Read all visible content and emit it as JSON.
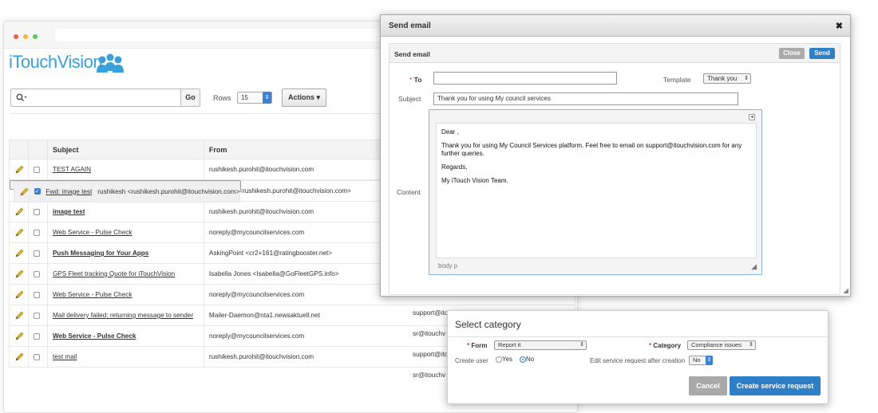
{
  "app": {
    "logo_text": "iTouchVision",
    "search": {
      "go_label": "Go",
      "placeholder": ""
    },
    "rows": {
      "label": "Rows",
      "value": "15"
    },
    "actions_label": "Actions"
  },
  "grid": {
    "columns": [
      "Subject",
      "From"
    ],
    "rows": [
      {
        "subject": "TEST AGAIN",
        "from": "rushikesh.purohit@itouchvision.com",
        "bold": false,
        "checked": false
      },
      {
        "subject": "Fwd: image test",
        "from": "rushikesh <rushikesh.purohit@itouchvision.com>",
        "bold": false,
        "checked": true
      },
      {
        "subject": "image test",
        "from": "rushikesh <rushikesh.purohit@itouchvision.com>",
        "bold": false,
        "checked": false
      },
      {
        "subject": "image test",
        "from": "rushikesh.purohit@itouchvision.com",
        "bold": true,
        "checked": false
      },
      {
        "subject": "Web Service - Pulse Check",
        "from": "noreply@mycouncilservices.com",
        "bold": false,
        "checked": false
      },
      {
        "subject": "Push Messaging for Your Apps",
        "from": "AskingPoint <cr2+161@ratingbooster.net>",
        "bold": true,
        "checked": false
      },
      {
        "subject": "GPS Fleet tracking Quote for iTouchVision",
        "from": "Isabella Jones <Isabella@GoFleetGPS.info>",
        "bold": false,
        "checked": false
      },
      {
        "subject": "Web Service - Pulse Check",
        "from": "noreply@mycouncilservices.com",
        "bold": false,
        "checked": false
      },
      {
        "subject": "Mail delivery failed: returning message to sender",
        "from": "Mailer-Daemon@nta1.newsaktuell.net",
        "bold": false,
        "checked": false
      },
      {
        "subject": "Web Service - Pulse Check",
        "from": "noreply@mycouncilservices.com",
        "bold": true,
        "checked": false
      },
      {
        "subject": "test mail",
        "from": "rushikesh.purohit@itouchvision.com",
        "bold": false,
        "checked": false
      }
    ],
    "partial_to": [
      "support@ito",
      "sr@itouchv",
      "support@ito",
      "sr@itouchv"
    ]
  },
  "send_email": {
    "window_title": "Send email",
    "panel_title": "Send email",
    "close_label": "Close",
    "send_label": "Send",
    "to_label": "To",
    "to_value": "",
    "template_label": "Template",
    "template_value": "Thank you",
    "subject_label": "Subject",
    "subject_value": "Thank you   for using My council services",
    "content_label": "Content",
    "content_lines": [
      "Dear ,",
      "Thank you for using My Council Services platform. Feel free to email on support@itouchvision.com for any further queries.",
      "Regards,",
      "My iTouch Vision Team."
    ],
    "status_path": "body  p"
  },
  "select_category": {
    "title": "Select category",
    "form_label": "Form",
    "form_value": "Report it",
    "category_label": "Category",
    "category_value": "Compliance issues",
    "create_user_label": "Create user",
    "yes_label": "Yes",
    "no_label": "No",
    "edit_label": "Edit service request after creation",
    "edit_value": "No",
    "cancel_label": "Cancel",
    "create_label": "Create service request"
  }
}
